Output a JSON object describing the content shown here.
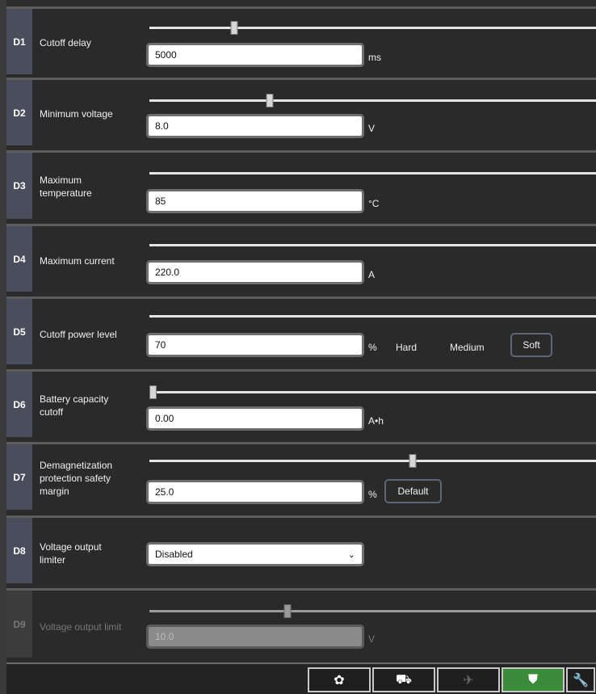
{
  "rows": [
    {
      "code": "D1",
      "name": "Cutoff delay",
      "value": "5000",
      "unit": "ms",
      "slider": 0.19
    },
    {
      "code": "D2",
      "name": "Minimum voltage",
      "value": "8.0",
      "unit": "V",
      "slider": 0.27
    },
    {
      "code": "D3",
      "name": "Maximum temperature",
      "value": "85",
      "unit": "°C",
      "slider": null
    },
    {
      "code": "D4",
      "name": "Maximum current",
      "value": "220.0",
      "unit": "A",
      "slider": null
    },
    {
      "code": "D5",
      "name": "Cutoff power level",
      "value": "70",
      "unit": "%",
      "slider": null,
      "options": {
        "hard": "Hard",
        "medium": "Medium",
        "soft": "Soft"
      }
    },
    {
      "code": "D6",
      "name": "Battery capacity cutoff",
      "value": "0.00",
      "unit": "A•h",
      "slider": 0.0
    },
    {
      "code": "D7",
      "name": "Demagnetization protection safety margin",
      "value": "25.0",
      "unit": "%",
      "slider": 0.59,
      "button": "Default"
    },
    {
      "code": "D8",
      "name": "Voltage output limiter",
      "value": "Disabled"
    },
    {
      "code": "D9",
      "name": "Voltage output limit",
      "value": "10.0",
      "unit": "V",
      "slider": 0.31,
      "disabled": true
    }
  ],
  "tabs": [
    {
      "icon": "gear-icon",
      "glyph": "✿"
    },
    {
      "icon": "helicopter-icon",
      "glyph": "⛟"
    },
    {
      "icon": "airplane-icon",
      "glyph": "✈"
    },
    {
      "icon": "shield-icon",
      "glyph": "⛊"
    },
    {
      "icon": "wrench-icon",
      "glyph": "🔧"
    }
  ]
}
